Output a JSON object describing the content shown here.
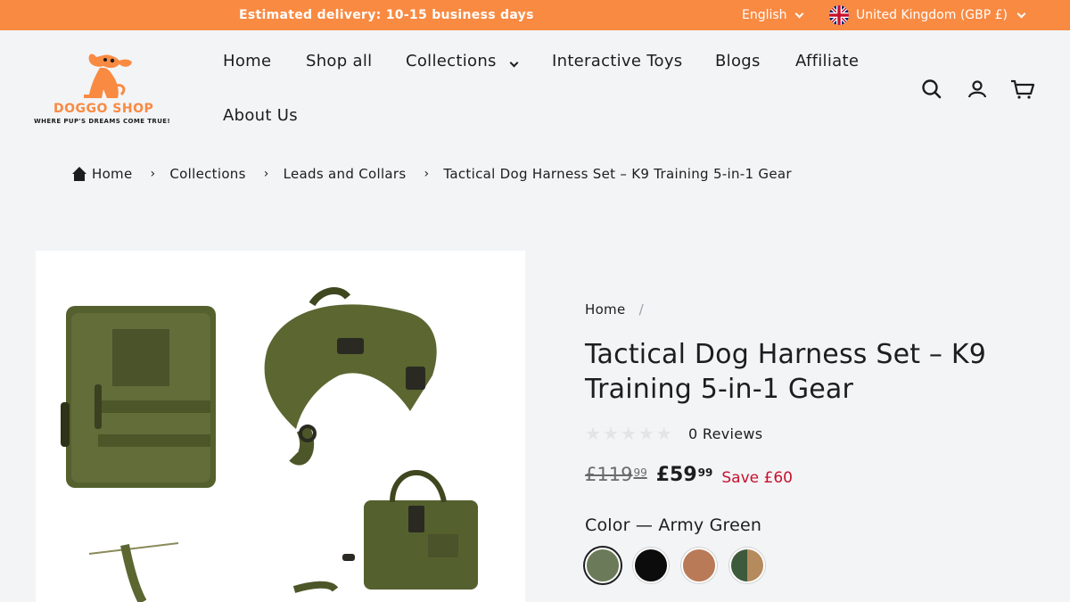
{
  "topbar": {
    "delivery": "Estimated delivery: 10-15 business days",
    "language": "English",
    "region": "United Kingdom (GBP £)"
  },
  "brand": {
    "name": "DOGGO SHOP",
    "tagline": "WHERE PUP'S DREAMS COME TRUE!",
    "accent": "#f98a42"
  },
  "nav": {
    "home": "Home",
    "shop_all": "Shop all",
    "collections": "Collections",
    "interactive_toys": "Interactive Toys",
    "blogs": "Blogs",
    "affiliate": "Affiliate",
    "about_us": "About Us"
  },
  "header_icons": [
    "search-icon",
    "account-icon",
    "cart-icon"
  ],
  "breadcrumb": {
    "home": "Home",
    "collections": "Collections",
    "leads": "Leads and Collars",
    "current": "Tactical Dog Harness Set – K9 Training 5-in-1 Gear",
    "sep": "›"
  },
  "product": {
    "crumb": "Home",
    "crumb_sep": "/",
    "title": "Tactical Dog Harness Set – K9 Training 5-in-1 Gear",
    "rating": 0,
    "reviews": "0 Reviews",
    "old_price_main": "£119",
    "old_price_cents": "99",
    "price_main": "£59",
    "price_cents": "99",
    "save": "Save £60",
    "color_label": "Color",
    "color_dash": "—",
    "color_value": "Army Green",
    "swatches": [
      {
        "name": "Army Green",
        "color": "#6b7a58"
      },
      {
        "name": "Black",
        "color": "#0c0c0c"
      },
      {
        "name": "Brown",
        "color": "#b97a58"
      },
      {
        "name": "Green/Brown",
        "color": "#3d5a3c"
      }
    ]
  }
}
